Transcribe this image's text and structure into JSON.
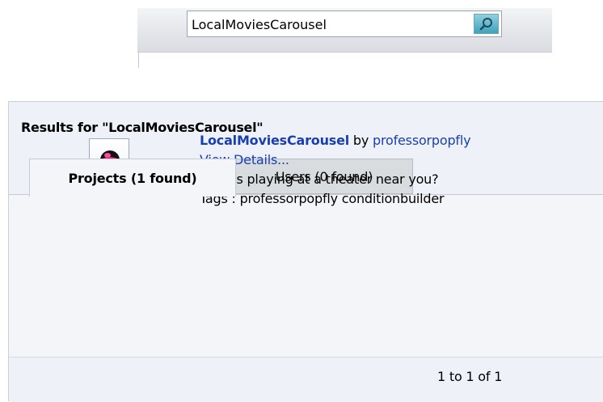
{
  "search": {
    "value": "LocalMoviesCarousel",
    "button_icon": "search-icon"
  },
  "results": {
    "title": "Results for \"LocalMoviesCarousel\"",
    "tabs": [
      {
        "label": "Projects (1 found)",
        "active": true
      },
      {
        "label": "Users (0 found)",
        "active": false
      }
    ],
    "items": [
      {
        "name": "LocalMoviesCarousel",
        "by_text": " by ",
        "author": "professorpopfly",
        "details_link": "View Details...",
        "description": "What's playing at a theater near you?",
        "tags": "Tags : professorpopfly conditionbuilder",
        "thumbnail_icon": "duck-icon"
      }
    ],
    "pager": "1 to 1 of 1"
  },
  "colors": {
    "link": "#1a3fb0",
    "panel_bg": "#eef2f8",
    "search_button": "#3fa2bb"
  }
}
